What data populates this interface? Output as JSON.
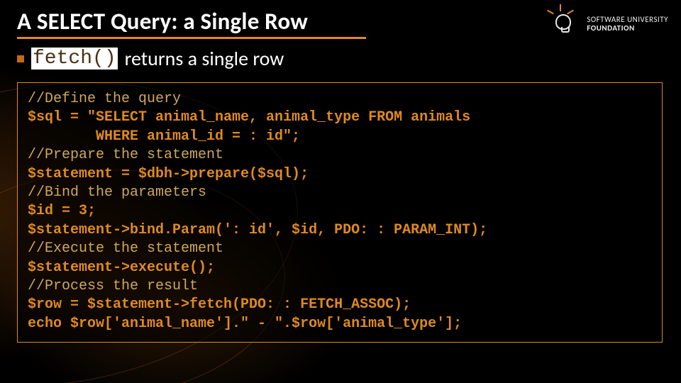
{
  "title": "A SELECT Query:  a Single Row",
  "bullet": {
    "fetch": "fetch()",
    "text": " returns a single row"
  },
  "code": {
    "l1": "//Define the query",
    "l2": "$sql = \"SELECT animal_name, animal_type FROM animals",
    "l3": "        WHERE animal_id = : id\";",
    "l4": "//Prepare the statement",
    "l5": "$statement = $dbh->prepare($sql);",
    "l6": "//Bind the parameters",
    "l7": "$id = 3;",
    "l8": "$statement->bind.Param(': id', $id, PDO: : PARAM_INT);",
    "l9": "//Execute the statement",
    "l10": "$statement->execute();",
    "l11": "//Process the result",
    "l12": "$row = $statement->fetch(PDO: : FETCH_ASSOC);",
    "l13": "echo $row['animal_name'].\" - \".$row['animal_type'];"
  },
  "logo": {
    "line1": "SOFTWARE UNIVERSITY",
    "line2": "FOUNDATION"
  }
}
